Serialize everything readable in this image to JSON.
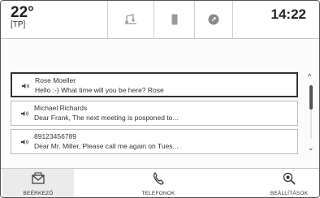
{
  "status": {
    "temperature": "22°",
    "zone": "[TP]",
    "time": "14:22",
    "icons": [
      "music-icon",
      "phone-device-icon",
      "navigation-icon"
    ]
  },
  "messages": [
    {
      "sender": "Rose Moeller",
      "text": "Hello :-) What time will you be here? Rose",
      "selected": true
    },
    {
      "sender": "Michael Richards",
      "text": "Dear Frank, The next meeting is posponed to...",
      "selected": false
    },
    {
      "sender": "89123456789",
      "text": "Dear Mr. Miller, Please call me again on Tues...",
      "selected": false
    }
  ],
  "nav": {
    "inbox_label": "BEÉRKEZŐ",
    "phones_label": "TELEFONOK",
    "settings_label": "BEÁLLÍTÁSOK"
  }
}
